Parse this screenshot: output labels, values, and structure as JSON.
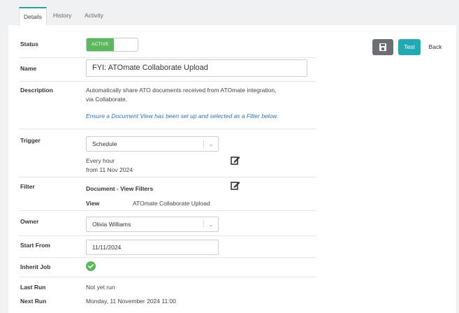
{
  "tabs": [
    {
      "label": "Details",
      "active": true
    },
    {
      "label": "History",
      "active": false
    },
    {
      "label": "Activity",
      "active": false
    }
  ],
  "actions": {
    "save_icon": "save-icon",
    "test_label": "Test",
    "back_label": "Back"
  },
  "fields": {
    "status": {
      "label": "Status",
      "value": "ACTIVE"
    },
    "name": {
      "label": "Name",
      "value": "FYI: ATOmate Collaborate Upload"
    },
    "description": {
      "label": "Description",
      "line1": "Automatically share ATO documents received from ATOmate integration,",
      "line2": "via Collaborate.",
      "note": "Ensure a Document View has been set up and selected as a Filter below."
    },
    "trigger": {
      "label": "Trigger",
      "selected": "Schedule",
      "freq": "Every hour",
      "from": "from 11 Nov 2024"
    },
    "filter": {
      "label": "Filter",
      "title": "Document - View Filters",
      "view_key": "View",
      "view_value": "ATOmate Collaborate Upload"
    },
    "owner": {
      "label": "Owner",
      "selected": "Olivia Williams"
    },
    "start_from": {
      "label": "Start From",
      "value": "11/11/2024"
    },
    "inherit_job": {
      "label": "Inherit Job",
      "checked": true
    },
    "last_run": {
      "label": "Last Run",
      "value": "Not yet run"
    },
    "next_run": {
      "label": "Next Run",
      "value": "Monday, 11 November 2024 11:00"
    }
  },
  "colors": {
    "accent": "#21aab3",
    "active_green": "#5cb85c",
    "note_blue": "#2f6fb0"
  }
}
